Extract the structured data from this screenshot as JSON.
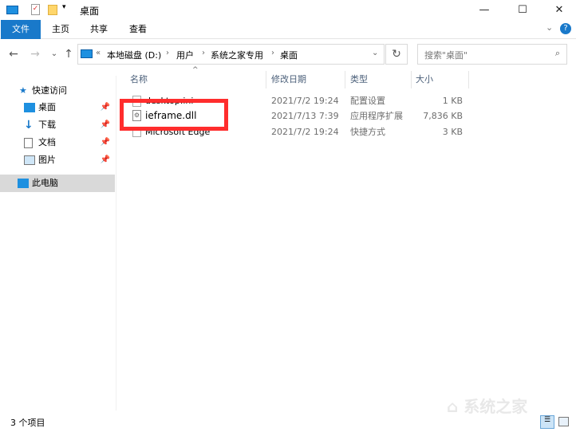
{
  "window": {
    "title": "桌面",
    "minimize": "—",
    "maximize": "☐",
    "close": "✕"
  },
  "ribbon": {
    "tabs": [
      "文件",
      "主页",
      "共享",
      "查看"
    ],
    "expand": "⌄",
    "help": "?"
  },
  "nav": {
    "back": "←",
    "forward": "→",
    "recent": "⌄",
    "up": "↑",
    "refresh": "↻"
  },
  "address": {
    "overflow": "«",
    "crumbs": [
      "本地磁盘 (D:)",
      "用户",
      "系统之家专用",
      "桌面"
    ],
    "dropdown": "⌄"
  },
  "search": {
    "placeholder": "搜索\"桌面\"",
    "icon": "search-icon"
  },
  "sidebar": {
    "quick_access": "快速访问",
    "items": [
      {
        "label": "桌面",
        "icon": "desktop-icon"
      },
      {
        "label": "下载",
        "icon": "download-icon"
      },
      {
        "label": "文档",
        "icon": "document-icon"
      },
      {
        "label": "图片",
        "icon": "picture-icon"
      }
    ],
    "this_pc": "此电脑"
  },
  "columns": [
    "名称",
    "修改日期",
    "类型",
    "大小"
  ],
  "files": [
    {
      "name": "desktop.ini",
      "date": "2021/7/2 19:24",
      "type": "配置设置",
      "size": "1 KB"
    },
    {
      "name": "ieframe.dll",
      "date": "2021/7/13 7:39",
      "type": "应用程序扩展",
      "size": "7,836 KB"
    },
    {
      "name": "Microsoft Edge",
      "date": "2021/7/2 19:24",
      "type": "快捷方式",
      "size": "3 KB"
    }
  ],
  "status": {
    "count": "3 个项目"
  },
  "watermark": "系统之家",
  "colors": {
    "accent": "#1979ca",
    "highlight": "#ff2d2d"
  }
}
